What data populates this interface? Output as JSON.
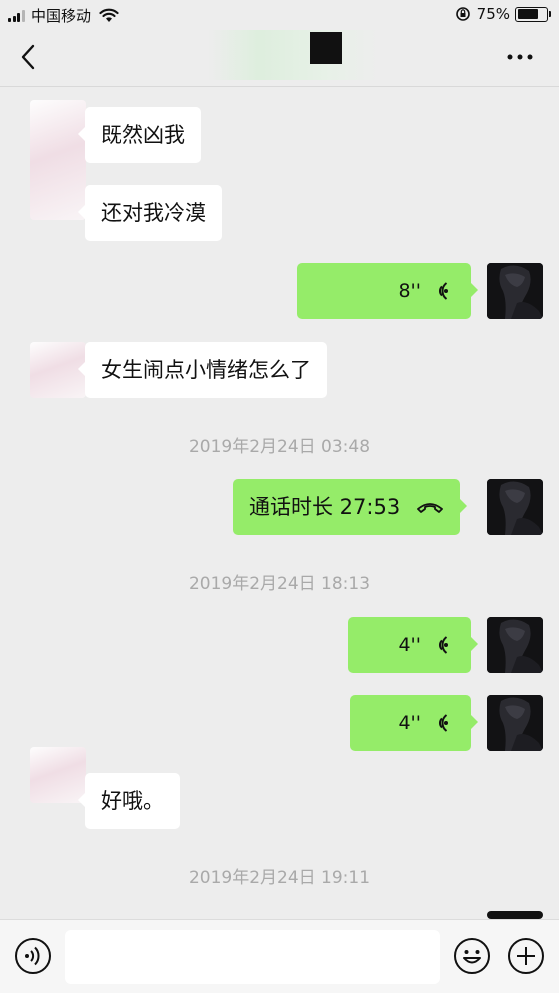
{
  "status": {
    "carrier": "中国移动",
    "battery_pct": "75%",
    "battery_level": 0.75,
    "signal_bars": 3
  },
  "nav": {
    "back_icon": "chevron-left-icon",
    "more_icon": "more-dots-icon"
  },
  "messages": [
    {
      "side": "in",
      "type": "text",
      "text": "既然凶我"
    },
    {
      "side": "in",
      "type": "text",
      "text": "还对我冷漠"
    },
    {
      "side": "out",
      "type": "voice",
      "duration": "8''"
    },
    {
      "side": "in",
      "type": "text",
      "text": "女生闹点小情绪怎么了"
    },
    {
      "type": "time",
      "text": "2019年2月24日 03:48"
    },
    {
      "side": "out",
      "type": "call",
      "text": "通话时长 27:53"
    },
    {
      "type": "time",
      "text": "2019年2月24日 18:13"
    },
    {
      "side": "out",
      "type": "voice",
      "duration": "4''"
    },
    {
      "side": "out",
      "type": "voice",
      "duration": "4''"
    },
    {
      "side": "in",
      "type": "text",
      "text": "好哦。"
    },
    {
      "type": "time",
      "text": "2019年2月24日 19:11"
    }
  ],
  "input_bar": {
    "placeholder": "",
    "voice_icon": "voice-input-icon",
    "emoji_icon": "emoji-icon",
    "plus_icon": "plus-icon"
  },
  "colors": {
    "background": "#ededed",
    "bubble_out": "#95ec69",
    "bubble_in": "#ffffff",
    "timestamp": "#a9a9a9"
  }
}
